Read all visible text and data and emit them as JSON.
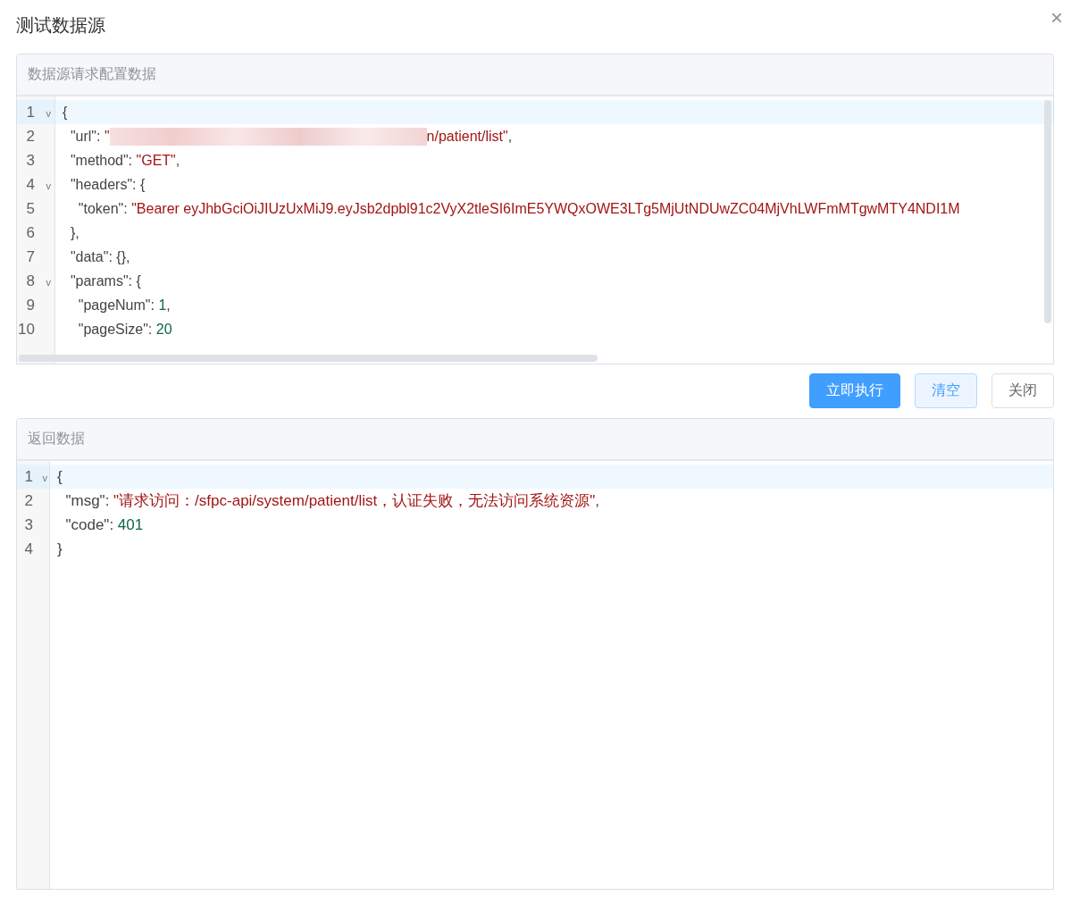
{
  "dialog": {
    "title": "测试数据源",
    "close": "×"
  },
  "request_panel": {
    "title": "数据源请求配置数据",
    "lines": [
      {
        "number": "1",
        "fold": "v",
        "active": true,
        "tokens": [
          {
            "kind": "punct",
            "text": "{"
          }
        ]
      },
      {
        "number": "2",
        "active": false,
        "tokens": [
          {
            "kind": "key",
            "text": "  \"url\": "
          },
          {
            "kind": "string",
            "text": "\""
          },
          {
            "kind": "redacted"
          },
          {
            "kind": "string",
            "text": "n/patient/list\""
          },
          {
            "kind": "punct",
            "text": ","
          }
        ]
      },
      {
        "number": "3",
        "active": false,
        "tokens": [
          {
            "kind": "key",
            "text": "  \"method\": "
          },
          {
            "kind": "string",
            "text": "\"GET\""
          },
          {
            "kind": "punct",
            "text": ","
          }
        ]
      },
      {
        "number": "4",
        "fold": "v",
        "active": false,
        "tokens": [
          {
            "kind": "key",
            "text": "  \"headers\": {"
          }
        ]
      },
      {
        "number": "5",
        "active": false,
        "tokens": [
          {
            "kind": "key",
            "text": "    \"token\": "
          },
          {
            "kind": "string",
            "text": "\"Bearer eyJhbGciOiJIUzUxMiJ9.eyJsb2dpbl91c2VyX2tleSI6ImE5YWQxOWE3LTg5MjUtNDUwZC04MjVhLWFmMTgwMTY4NDI1M"
          }
        ]
      },
      {
        "number": "6",
        "active": false,
        "tokens": [
          {
            "kind": "punct",
            "text": "  },"
          }
        ]
      },
      {
        "number": "7",
        "active": false,
        "tokens": [
          {
            "kind": "key",
            "text": "  \"data\": {},"
          }
        ]
      },
      {
        "number": "8",
        "fold": "v",
        "active": false,
        "tokens": [
          {
            "kind": "key",
            "text": "  \"params\": {"
          }
        ]
      },
      {
        "number": "9",
        "active": false,
        "tokens": [
          {
            "kind": "key",
            "text": "    \"pageNum\": "
          },
          {
            "kind": "number",
            "text": "1"
          },
          {
            "kind": "punct",
            "text": ","
          }
        ]
      },
      {
        "number": "10",
        "active": false,
        "tokens": [
          {
            "kind": "key",
            "text": "    \"pageSize\": "
          },
          {
            "kind": "number",
            "text": "20"
          }
        ]
      }
    ]
  },
  "buttons": [
    {
      "label": "立即执行",
      "kind": "primary"
    },
    {
      "label": "清空",
      "kind": "plain"
    },
    {
      "label": "关闭",
      "kind": "default"
    }
  ],
  "response_panel": {
    "title": "返回数据",
    "lines": [
      {
        "number": "1",
        "fold": "v",
        "active": true,
        "tokens": [
          {
            "kind": "punct",
            "text": "{"
          }
        ]
      },
      {
        "number": "2",
        "active": false,
        "tokens": [
          {
            "kind": "key",
            "text": "  \"msg\": "
          },
          {
            "kind": "string",
            "text": "\"请求访问：/sfpc-api/system/patient/list，认证失败，无法访问系统资源\""
          },
          {
            "kind": "punct",
            "text": ","
          }
        ]
      },
      {
        "number": "3",
        "active": false,
        "tokens": [
          {
            "kind": "key",
            "text": "  \"code\": "
          },
          {
            "kind": "number",
            "text": "401"
          }
        ]
      },
      {
        "number": "4",
        "active": false,
        "tokens": [
          {
            "kind": "punct",
            "text": "}"
          }
        ]
      }
    ]
  }
}
